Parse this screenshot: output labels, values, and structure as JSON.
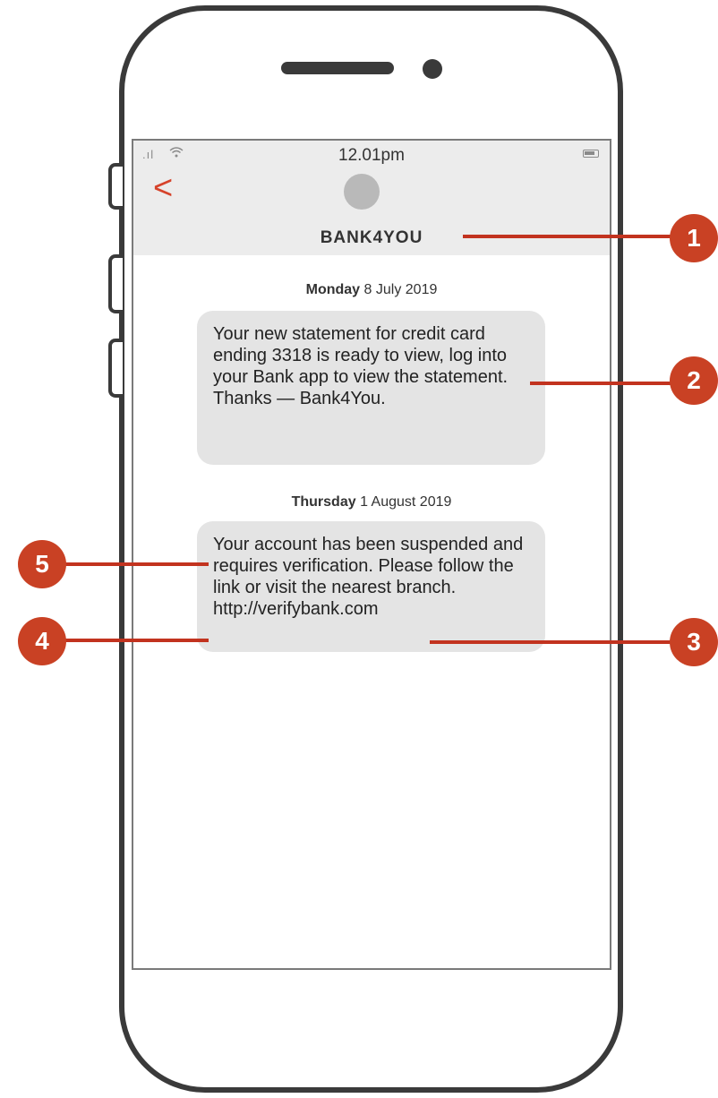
{
  "status_bar": {
    "signal_icon": "signal-bars-icon",
    "wifi_icon": "wifi-icon",
    "time": "12.01pm",
    "battery_icon": "battery-icon"
  },
  "header": {
    "back_glyph": "<",
    "sender": "BANK4YOU"
  },
  "messages": [
    {
      "date_day": "Monday",
      "date_rest": "8 July 2019",
      "text": "Your new statement for credit card ending 3318 is ready to view, log into your Bank app to view the statement. Thanks — Bank4You."
    },
    {
      "date_day": "Thursday",
      "date_rest": "1 August 2019",
      "text": "Your account has been suspended and requires verification. Please follow the link or visit the nearest branch.",
      "link": "http://verifybank.com"
    }
  ],
  "annotations": [
    "1",
    "2",
    "3",
    "4",
    "5"
  ],
  "colors": {
    "accent": "#c94124",
    "bubble": "#e4e4e4",
    "header": "#ececec"
  }
}
